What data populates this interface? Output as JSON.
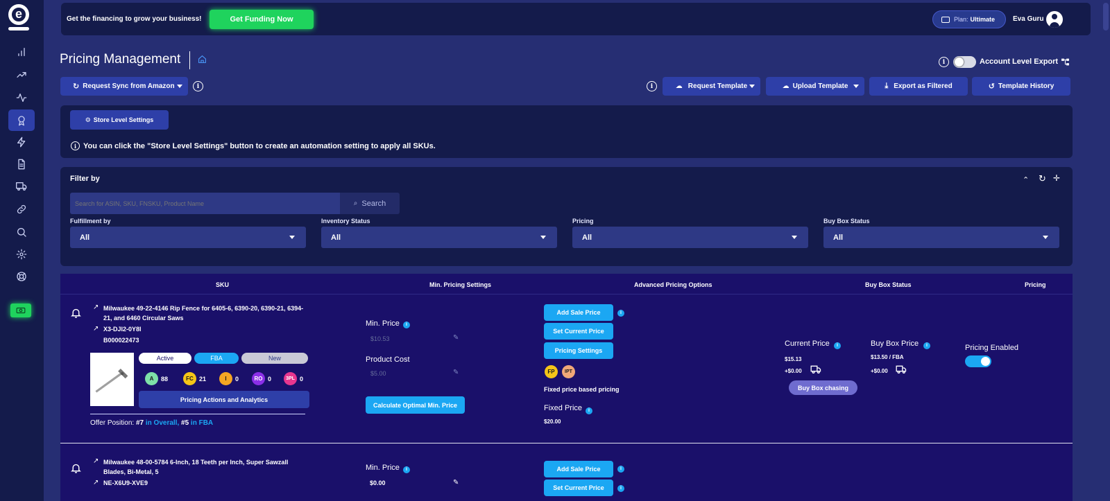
{
  "brand": {
    "logo_letter": "e"
  },
  "sidebar": {
    "items": [
      {
        "icon": "bar-chart-icon"
      },
      {
        "icon": "trending-up-icon"
      },
      {
        "icon": "activity-icon"
      },
      {
        "icon": "award-icon"
      },
      {
        "icon": "lightning-icon"
      },
      {
        "icon": "document-icon"
      },
      {
        "icon": "truck-icon"
      },
      {
        "icon": "link-icon"
      },
      {
        "icon": "search-icon"
      },
      {
        "icon": "gear-icon"
      },
      {
        "icon": "lifebuoy-icon"
      },
      {
        "icon": "cash-icon"
      }
    ],
    "active_index": 3
  },
  "banner": {
    "text": "Get the financing to grow your business!",
    "cta": "Get Funding Now",
    "plan_prefix": "Plan:",
    "plan_name": "Ultimate",
    "user_name": "Eva Guru"
  },
  "page": {
    "title": "Pricing Management",
    "account_export_label": "Account Level Export"
  },
  "toolbar": {
    "request_sync": "Request Sync from Amazon",
    "request_template": "Request Template",
    "upload_template": "Upload Template",
    "export_filtered": "Export as Filtered",
    "template_history": "Template History"
  },
  "store_settings": {
    "button": "Store Level Settings",
    "notice": "You can click the \"Store Level Settings\" button to create an automation setting to apply all SKUs."
  },
  "filter": {
    "title": "Filter by",
    "search_placeholder": "Search for ASIN, SKU, FNSKU, Product Name",
    "search_button": "Search",
    "fields": [
      {
        "label": "Fulfillment by",
        "value": "All"
      },
      {
        "label": "Inventory Status",
        "value": "All"
      },
      {
        "label": "Pricing",
        "value": "All"
      },
      {
        "label": "Buy Box Status",
        "value": "All"
      }
    ]
  },
  "table": {
    "headers": [
      "SKU",
      "Min. Pricing Settings",
      "Advanced Pricing Options",
      "Buy Box Status",
      "Pricing"
    ],
    "rows": [
      {
        "title": "Milwaukee 49-22-4146 Rip Fence for 6405-6, 6390-20, 6390-21, 6394-21, and 6460 Circular Saws",
        "sku": "X3-DJI2-0Y8I",
        "asin": "B000022473",
        "status": "Active",
        "channel": "FBA",
        "condition": "New",
        "badges": [
          {
            "code": "A",
            "count": "88",
            "color": "#7ee0a8"
          },
          {
            "code": "FC",
            "count": "21",
            "color": "#f5c518"
          },
          {
            "code": "I",
            "count": "0",
            "color": "#f5a623"
          },
          {
            "code": "RO",
            "count": "0",
            "color": "#8b2fe8"
          },
          {
            "code": "3PL",
            "count": "0",
            "color": "#e8368f"
          }
        ],
        "actions_button": "Pricing Actions and Analytics",
        "offer_position_label": "Offer Position:",
        "offer_overall_rank": "#7",
        "offer_overall_text": "in Overall,",
        "offer_fba_rank": "#5",
        "offer_fba_text": "in FBA",
        "min_price_label": "Min. Price",
        "min_price_value": "$10.53",
        "product_cost_label": "Product Cost",
        "product_cost_value": "$5.00",
        "calc_button": "Calculate Optimal Min. Price",
        "add_sale_price": "Add Sale Price",
        "set_current_price": "Set Current Price",
        "pricing_settings": "Pricing Settings",
        "tags": [
          "FP",
          "IPT"
        ],
        "strategy_text": "Fixed price based pricing",
        "fixed_price_label": "Fixed Price",
        "fixed_price_value": "$20.00",
        "current_price_label": "Current Price",
        "current_price_value": "$15.13",
        "current_shipping": "+$0.00",
        "buybox_price_label": "Buy Box Price",
        "buybox_price_value": "$13.50 / FBA",
        "buybox_shipping": "+$0.00",
        "buybox_chasing": "Buy Box chasing",
        "pricing_status": "Pricing Enabled"
      },
      {
        "title": "Milwaukee 48-00-5784 6-Inch, 18 Teeth per Inch, Super Sawzall Blades, Bi-Metal, 5",
        "sku": "NE-X6U9-XVE9",
        "min_price_label": "Min. Price",
        "min_price_value": "$0.00",
        "add_sale_price": "Add Sale Price",
        "set_current_price": "Set Current Price"
      }
    ]
  },
  "colors": {
    "background": "#262e73",
    "panel": "#141b4b",
    "accent_blue": "#2e3fa8",
    "cyan": "#1ba7f3",
    "green_cta": "#1fd35d"
  }
}
